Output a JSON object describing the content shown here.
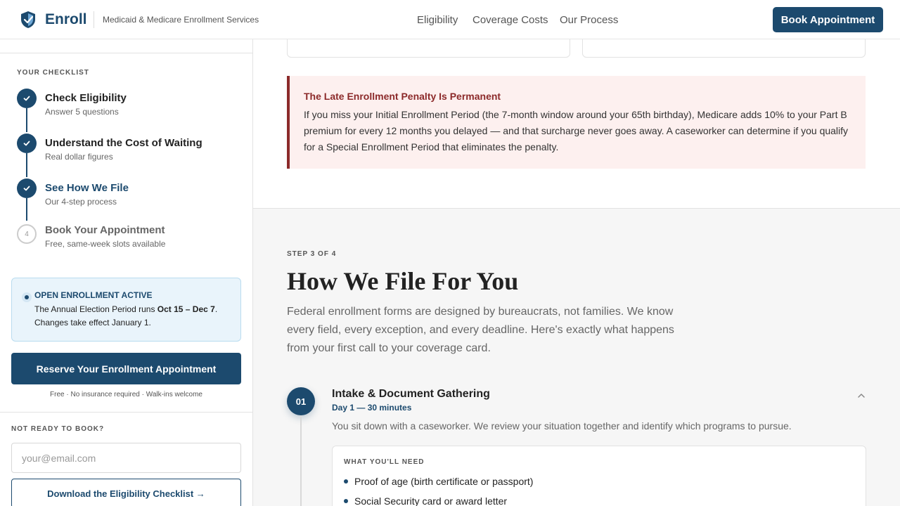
{
  "header": {
    "brand": "Enroll",
    "tagline": "Medicaid & Medicare Enrollment Services",
    "nav": [
      "Eligibility",
      "Coverage Costs",
      "Our Process"
    ],
    "book_button": "Book Appointment"
  },
  "sidebar": {
    "checklist_label": "YOUR CHECKLIST",
    "steps": [
      {
        "title": "Check Eligibility",
        "subtitle": "Answer 5 questions",
        "state": "done"
      },
      {
        "title": "Understand the Cost of Waiting",
        "subtitle": "Real dollar figures",
        "state": "done"
      },
      {
        "title": "See How We File",
        "subtitle": "Our 4-step process",
        "state": "current"
      },
      {
        "number": "4",
        "title": "Book Your Appointment",
        "subtitle": "Free, same-week slots available",
        "state": "pending"
      }
    ],
    "enrollment": {
      "title": "OPEN ENROLLMENT ACTIVE",
      "text_before": "The Annual Election Period runs ",
      "dates": "Oct 15 – Dec 7",
      "text_after": ". Changes take effect January 1."
    },
    "reserve_button": "Reserve Your Enrollment Appointment",
    "fine_print": "Free · No insurance required · Walk-ins welcome",
    "not_ready_label": "NOT READY TO BOOK?",
    "email_placeholder": "your@email.com",
    "download_button": "Download the Eligibility Checklist →"
  },
  "penalty": {
    "title": "The Late Enrollment Penalty Is Permanent",
    "text": "If you miss your Initial Enrollment Period (the 7-month window around your 65th birthday), Medicare adds 10% to your Part B premium for every 12 months you delayed — and that surcharge never goes away. A caseworker can determine if you qualify for a Special Enrollment Period that eliminates the penalty."
  },
  "process": {
    "step_of": "STEP 3 OF 4",
    "title": "How We File For You",
    "intro": "Federal enrollment forms are designed by bureaucrats, not families. We know every field, every exception, and every deadline. Here's exactly what happens from your first call to your coverage card.",
    "item": {
      "number": "01",
      "title": "Intake & Document Gathering",
      "time": "Day 1 — 30 minutes",
      "description": "You sit down with a caseworker. We review your situation together and identify which programs to pursue.",
      "needs_label": "WHAT YOU'LL NEED",
      "needs": [
        "Proof of age (birth certificate or passport)",
        "Social Security card or award letter"
      ]
    }
  },
  "colors": {
    "primary": "#1c4a6e",
    "penalty_accent": "#8c2a2a",
    "penalty_bg": "#fdf0ef",
    "info_bg": "#e9f4fb"
  }
}
